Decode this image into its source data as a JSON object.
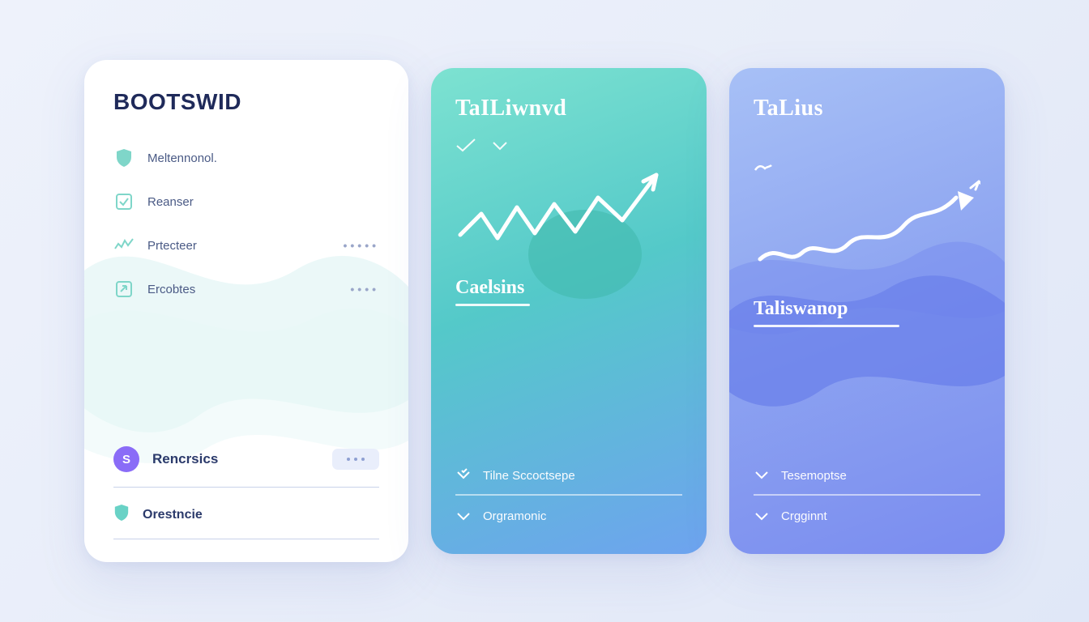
{
  "card1": {
    "title": "BOOTSWID",
    "items": [
      {
        "icon": "shield",
        "label": "Meltennonol.",
        "dots": ""
      },
      {
        "icon": "check-square",
        "label": "Reanser",
        "dots": ""
      },
      {
        "icon": "spark",
        "label": "Prtecteer",
        "dots": "•••••"
      },
      {
        "icon": "arrow-square",
        "label": "Ercobtes",
        "dots": "••••"
      }
    ],
    "badge_char": "S",
    "badge_label": "Rencrsics",
    "last_label": "Orestncie"
  },
  "card2": {
    "title": "TaILiwnvd",
    "subhead": "Caelsins",
    "features": [
      {
        "label": "Tilne Sccoctsepe"
      },
      {
        "label": "Orgramonic"
      }
    ]
  },
  "card3": {
    "title": "TaLius",
    "subhead": "Taliswanop",
    "features": [
      {
        "label": "Tesemoptse"
      },
      {
        "label": "Crgginnt"
      }
    ]
  },
  "colors": {
    "navy": "#1f2a5a",
    "teal": "#54c9c9",
    "violet": "#8a6cf7",
    "blue": "#7a8cf0"
  }
}
